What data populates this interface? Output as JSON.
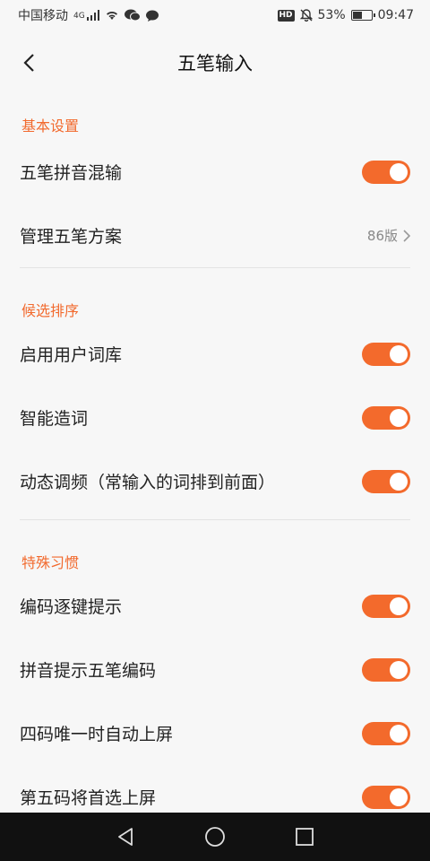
{
  "status_bar": {
    "carrier": "中国移动",
    "network": "4G",
    "hd": "HD",
    "battery_percent": "53%",
    "battery_level": 0.53,
    "time": "09:47"
  },
  "header": {
    "title": "五笔输入"
  },
  "sections": [
    {
      "title": "基本设置",
      "items": [
        {
          "label": "五笔拼音混输",
          "type": "toggle",
          "on": true
        },
        {
          "label": "管理五笔方案",
          "type": "link",
          "value": "86版"
        }
      ]
    },
    {
      "title": "候选排序",
      "items": [
        {
          "label": "启用用户词库",
          "type": "toggle",
          "on": true
        },
        {
          "label": "智能造词",
          "type": "toggle",
          "on": true
        },
        {
          "label": "动态调频（常输入的词排到前面）",
          "type": "toggle",
          "on": true
        }
      ]
    },
    {
      "title": "特殊习惯",
      "items": [
        {
          "label": "编码逐键提示",
          "type": "toggle",
          "on": true
        },
        {
          "label": "拼音提示五笔编码",
          "type": "toggle",
          "on": true
        },
        {
          "label": "四码唯一时自动上屏",
          "type": "toggle",
          "on": true
        },
        {
          "label": "第五码将首选上屏",
          "type": "toggle",
          "on": true
        }
      ]
    }
  ],
  "colors": {
    "accent": "#f26a2e",
    "background": "#f7f7f7",
    "nav_bar": "#111111"
  }
}
